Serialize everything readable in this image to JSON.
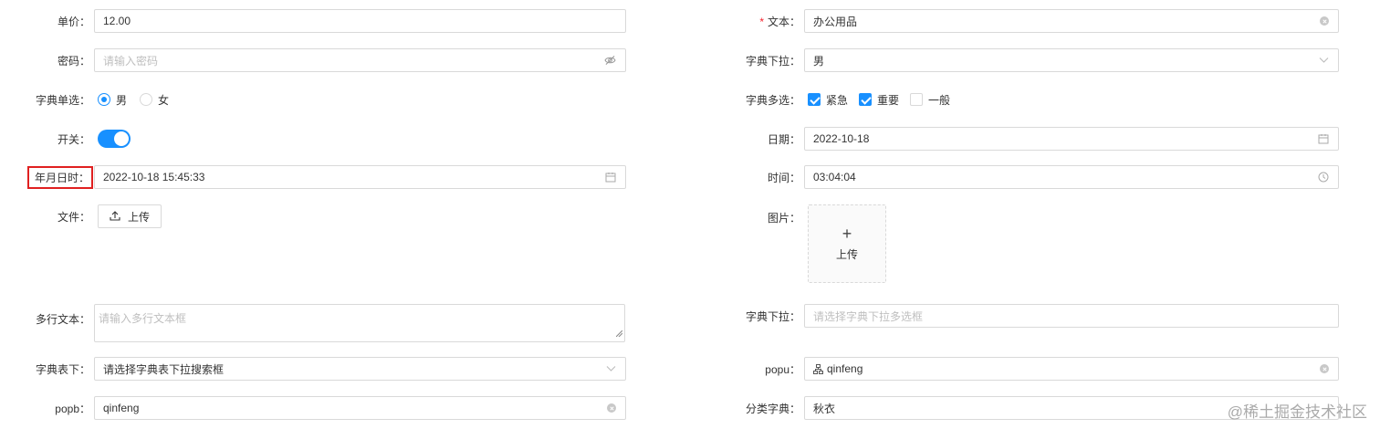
{
  "left": {
    "price": {
      "label": "单价：",
      "value": "12.00"
    },
    "password": {
      "label": "密码：",
      "placeholder": "请输入密码",
      "icon": "eye-slash-icon"
    },
    "dict_radio": {
      "label": "字典单选：",
      "options": [
        "男",
        "女"
      ],
      "selected": "男"
    },
    "switch": {
      "label": "开关：",
      "on": true
    },
    "datetime": {
      "label": "年月日时：",
      "value": "2022-10-18 15:45:33",
      "icon": "calendar-icon"
    },
    "file": {
      "label": "文件：",
      "button": "上传",
      "icon": "upload-icon"
    },
    "textarea": {
      "label": "多行文本：",
      "placeholder": "请输入多行文本框"
    },
    "dict_table": {
      "label": "字典表下：",
      "placeholder": "请选择字典表下拉搜索框",
      "icon": "chevron-down-icon"
    },
    "popb": {
      "label": "popb：",
      "value": "qinfeng",
      "icon": "clear-icon"
    }
  },
  "right": {
    "text": {
      "required_mark": "*",
      "label": "文本：",
      "value": "办公用品",
      "icon": "clear-icon"
    },
    "dict_select": {
      "label": "字典下拉：",
      "value": "男",
      "icon": "chevron-down-icon"
    },
    "dict_checkbox": {
      "label": "字典多选：",
      "options": [
        {
          "label": "紧急",
          "checked": true
        },
        {
          "label": "重要",
          "checked": true
        },
        {
          "label": "一般",
          "checked": false
        }
      ]
    },
    "date": {
      "label": "日期：",
      "value": "2022-10-18",
      "icon": "calendar-icon"
    },
    "time": {
      "label": "时间：",
      "value": "03:04:04",
      "icon": "clock-icon"
    },
    "image": {
      "label": "图片：",
      "plus": "+",
      "text": "上传"
    },
    "dict_multi": {
      "label": "字典下拉：",
      "placeholder": "请选择字典下拉多选框"
    },
    "popu": {
      "label": "popu：",
      "value": "qinfeng",
      "icon": "org-tree-icon"
    },
    "category": {
      "label": "分类字典：",
      "value": "秋衣"
    }
  },
  "watermark": "@稀土掘金技术社区"
}
